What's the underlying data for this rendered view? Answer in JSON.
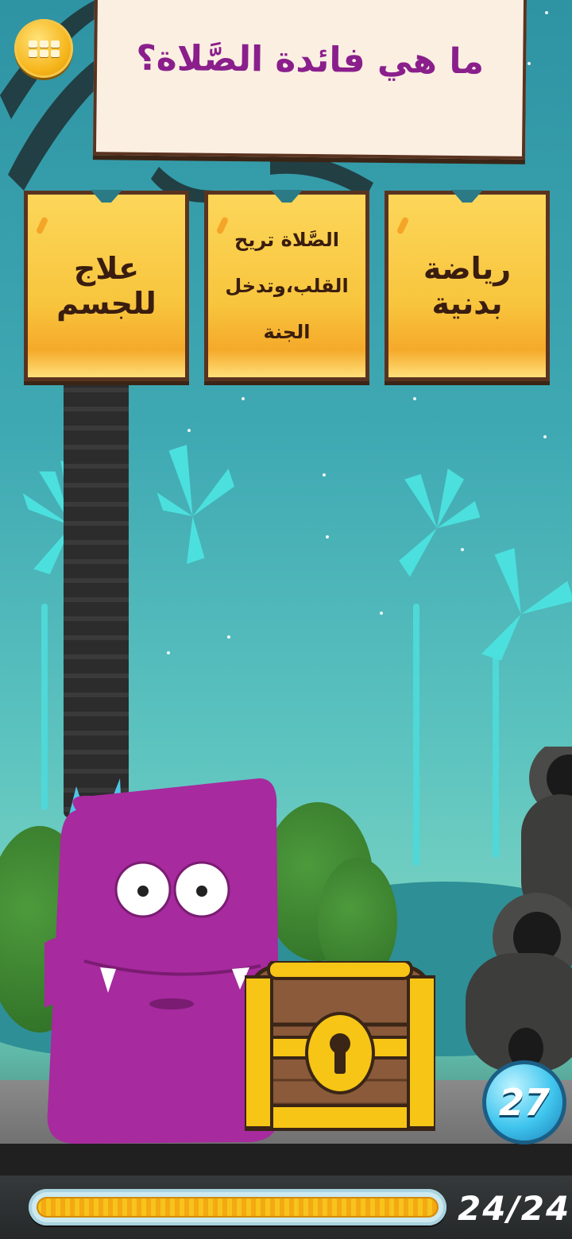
{
  "game": {
    "question": "ما هي فائدة الصَّلاة؟",
    "answers": [
      {
        "text": "علاج للجسم"
      },
      {
        "text": "الصَّلاة تريح القلب،وتدخل الجنة"
      },
      {
        "text": "رياضة بدنية"
      }
    ],
    "menu_icon": "grid-menu-icon",
    "coins": "27",
    "progress": {
      "label": "24/24",
      "current": 24,
      "total": 24
    }
  },
  "colors": {
    "question_text": "#8a1f8c",
    "card_fill": "#f8c53d",
    "card_border": "#5a3320",
    "monster": "#a72a9e",
    "progress_fill": "#f7c31c"
  }
}
